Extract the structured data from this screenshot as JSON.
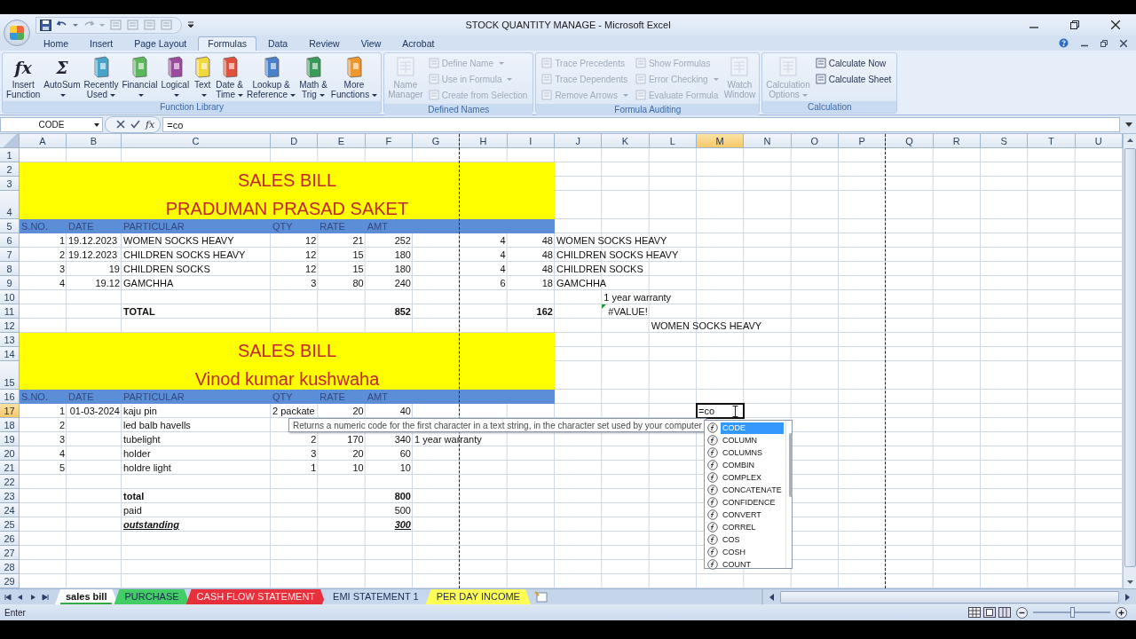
{
  "window": {
    "title": "STOCK QUANTITY MANAGE - Microsoft Excel"
  },
  "ribbon": {
    "tabs": [
      {
        "label": "Home",
        "selected": false
      },
      {
        "label": "Insert",
        "selected": false
      },
      {
        "label": "Page Layout",
        "selected": false
      },
      {
        "label": "Formulas",
        "selected": true
      },
      {
        "label": "Data",
        "selected": false
      },
      {
        "label": "Review",
        "selected": false
      },
      {
        "label": "View",
        "selected": false
      },
      {
        "label": "Acrobat",
        "selected": false
      }
    ],
    "groups": [
      {
        "label": "Function Library",
        "items": [
          {
            "kind": "glyph",
            "glyph": "fx",
            "lines": [
              "Insert",
              "Function"
            ],
            "menu": false,
            "disabled": false
          },
          {
            "kind": "glyph",
            "glyph": "Σ",
            "lines": [
              "AutoSum"
            ],
            "menu": true,
            "disabled": false
          },
          {
            "kind": "book",
            "color": "#4aa3c8",
            "lines": [
              "Recently",
              "Used"
            ],
            "menu": true,
            "disabled": false
          },
          {
            "kind": "book",
            "color": "#5cb85c",
            "lines": [
              "Financial"
            ],
            "menu": true,
            "disabled": false
          },
          {
            "kind": "book",
            "color": "#9b4aa0",
            "lines": [
              "Logical"
            ],
            "menu": true,
            "disabled": false
          },
          {
            "kind": "book",
            "color": "#f0d840",
            "lines": [
              "Text"
            ],
            "menu": true,
            "disabled": false
          },
          {
            "kind": "book",
            "color": "#e0503a",
            "lines": [
              "Date &",
              "Time"
            ],
            "menu": true,
            "disabled": false
          },
          {
            "kind": "book",
            "color": "#4a80c8",
            "lines": [
              "Lookup &",
              "Reference"
            ],
            "menu": true,
            "disabled": false
          },
          {
            "kind": "book",
            "color": "#3a9a5a",
            "lines": [
              "Math &",
              "Trig"
            ],
            "menu": true,
            "disabled": false
          },
          {
            "kind": "book",
            "color": "#f0962a",
            "lines": [
              "More",
              "Functions"
            ],
            "menu": true,
            "disabled": false
          }
        ]
      },
      {
        "label": "Defined Names",
        "items": [
          {
            "kind": "large",
            "lines": [
              "Name",
              "Manager"
            ],
            "menu": false,
            "disabled": true
          },
          {
            "kind": "small",
            "lines": [
              "Define Name"
            ],
            "menu": true,
            "disabled": true
          },
          {
            "kind": "small",
            "lines": [
              "Use in Formula"
            ],
            "menu": true,
            "disabled": true
          },
          {
            "kind": "small",
            "lines": [
              "Create from Selection"
            ],
            "menu": false,
            "disabled": true
          }
        ]
      },
      {
        "label": "Formula Auditing",
        "items": [
          {
            "kind": "small",
            "lines": [
              "Trace Precedents"
            ],
            "menu": false,
            "disabled": true
          },
          {
            "kind": "small",
            "lines": [
              "Trace Dependents"
            ],
            "menu": false,
            "disabled": true
          },
          {
            "kind": "small",
            "lines": [
              "Remove Arrows"
            ],
            "menu": true,
            "disabled": true
          },
          {
            "kind": "small",
            "lines": [
              "Show Formulas"
            ],
            "menu": false,
            "disabled": true
          },
          {
            "kind": "small",
            "lines": [
              "Error Checking"
            ],
            "menu": true,
            "disabled": true
          },
          {
            "kind": "small",
            "lines": [
              "Evaluate Formula"
            ],
            "menu": false,
            "disabled": true
          },
          {
            "kind": "large",
            "lines": [
              "Watch",
              "Window"
            ],
            "menu": false,
            "disabled": true
          }
        ]
      },
      {
        "label": "Calculation",
        "items": [
          {
            "kind": "large",
            "lines": [
              "Calculation",
              "Options"
            ],
            "menu": true,
            "disabled": true
          },
          {
            "kind": "small",
            "lines": [
              "Calculate Now"
            ],
            "menu": false,
            "disabled": false
          },
          {
            "kind": "small",
            "lines": [
              "Calculate Sheet"
            ],
            "menu": false,
            "disabled": false
          }
        ]
      }
    ]
  },
  "formula_bar": {
    "name_box": "CODE",
    "function_button": "fx",
    "formula": "=co"
  },
  "sheet": {
    "columns": [
      {
        "label": "A",
        "page_break_after": false
      },
      {
        "label": "B",
        "page_break_after": false
      },
      {
        "label": "C",
        "page_break_after": false
      },
      {
        "label": "D",
        "page_break_after": false
      },
      {
        "label": "E",
        "page_break_after": false
      },
      {
        "label": "F",
        "page_break_after": false
      },
      {
        "label": "G",
        "page_break_after": true
      },
      {
        "label": "H",
        "page_break_after": false
      },
      {
        "label": "I",
        "page_break_after": false
      },
      {
        "label": "J",
        "page_break_after": false
      },
      {
        "label": "K",
        "page_break_after": false
      },
      {
        "label": "L",
        "page_break_after": false
      },
      {
        "label": "M",
        "page_break_after": false
      },
      {
        "label": "N",
        "page_break_after": false
      },
      {
        "label": "O",
        "page_break_after": false
      },
      {
        "label": "P",
        "page_break_after": true
      },
      {
        "label": "Q",
        "page_break_after": false
      },
      {
        "label": "R",
        "page_break_after": false
      },
      {
        "label": "S",
        "page_break_after": false
      },
      {
        "label": "T",
        "page_break_after": false
      },
      {
        "label": "U",
        "page_break_after": false
      }
    ],
    "rows": [
      {
        "label": "1",
        "kind": "plain"
      },
      {
        "label": "2",
        "kind": "title",
        "title": "SALES BILL"
      },
      {
        "label": "3",
        "kind": "title"
      },
      {
        "label": "4",
        "kind": "title",
        "title": "PRADUMAN PRASAD SAKET"
      },
      {
        "label": "5",
        "kind": "header",
        "cells": {
          "A": {
            "text": "S.NO.",
            "kind": "header"
          },
          "B": {
            "text": "DATE",
            "kind": "header"
          },
          "C": {
            "text": "PARTICULAR",
            "kind": "header"
          },
          "D": {
            "text": "QTY",
            "kind": "header"
          },
          "E": {
            "text": "RATE",
            "kind": "header"
          },
          "F": {
            "text": "AMT",
            "kind": "header"
          }
        }
      },
      {
        "label": "6",
        "kind": "plain",
        "cells": {
          "A": {
            "text": "1",
            "kind": "num"
          },
          "B": {
            "text": "19.12.2023",
            "kind": "text"
          },
          "C": {
            "text": "WOMEN SOCKS HEAVY",
            "kind": "text"
          },
          "D": {
            "text": "12",
            "kind": "num"
          },
          "E": {
            "text": "21",
            "kind": "num"
          },
          "F": {
            "text": "252",
            "kind": "num"
          },
          "H": {
            "text": "4",
            "kind": "num"
          },
          "I": {
            "text": "48",
            "kind": "num"
          },
          "J": {
            "text": "WOMEN SOCKS HEAVY",
            "kind": "text"
          }
        }
      },
      {
        "label": "7",
        "kind": "plain",
        "cells": {
          "A": {
            "text": "2",
            "kind": "num"
          },
          "B": {
            "text": "19.12.2023",
            "kind": "text"
          },
          "C": {
            "text": "CHILDREN SOCKS HEAVY",
            "kind": "text"
          },
          "D": {
            "text": "12",
            "kind": "num"
          },
          "E": {
            "text": "15",
            "kind": "num"
          },
          "F": {
            "text": "180",
            "kind": "num"
          },
          "H": {
            "text": "4",
            "kind": "num"
          },
          "I": {
            "text": "48",
            "kind": "num"
          },
          "J": {
            "text": "CHILDREN SOCKS HEAVY",
            "kind": "text"
          }
        }
      },
      {
        "label": "8",
        "kind": "plain",
        "cells": {
          "A": {
            "text": "3",
            "kind": "num"
          },
          "B": {
            "text": "19",
            "kind": "num"
          },
          "C": {
            "text": "CHILDREN SOCKS",
            "kind": "text"
          },
          "D": {
            "text": "12",
            "kind": "num"
          },
          "E": {
            "text": "15",
            "kind": "num"
          },
          "F": {
            "text": "180",
            "kind": "num"
          },
          "H": {
            "text": "4",
            "kind": "num"
          },
          "I": {
            "text": "48",
            "kind": "num"
          },
          "J": {
            "text": "CHILDREN SOCKS",
            "kind": "text"
          }
        }
      },
      {
        "label": "9",
        "kind": "plain",
        "cells": {
          "A": {
            "text": "4",
            "kind": "num"
          },
          "B": {
            "text": "19.12",
            "kind": "num"
          },
          "C": {
            "text": "GAMCHHA",
            "kind": "text"
          },
          "D": {
            "text": "3",
            "kind": "num"
          },
          "E": {
            "text": "80",
            "kind": "num"
          },
          "F": {
            "text": "240",
            "kind": "num"
          },
          "H": {
            "text": "6",
            "kind": "num"
          },
          "I": {
            "text": "18",
            "kind": "num"
          },
          "J": {
            "text": "GAMCHHA",
            "kind": "text"
          }
        }
      },
      {
        "label": "10",
        "kind": "plain",
        "cells": {
          "K": {
            "text": "1 year warranty",
            "kind": "text"
          }
        }
      },
      {
        "label": "11",
        "kind": "plain",
        "cells": {
          "C": {
            "text": "TOTAL",
            "kind": "text-bold"
          },
          "F": {
            "text": "852",
            "kind": "num-bold"
          },
          "I": {
            "text": "162",
            "kind": "num-bold"
          },
          "K": {
            "text": "#VALUE!",
            "kind": "error"
          }
        }
      },
      {
        "label": "12",
        "kind": "plain",
        "cells": {
          "L": {
            "text": "WOMEN SOCKS HEAVY",
            "kind": "text"
          }
        }
      },
      {
        "label": "13",
        "kind": "title",
        "title": "SALES BILL"
      },
      {
        "label": "14",
        "kind": "title"
      },
      {
        "label": "15",
        "kind": "title",
        "title": "Vinod kumar kushwaha"
      },
      {
        "label": "16",
        "kind": "header",
        "cells": {
          "A": {
            "text": "S.NO.",
            "kind": "header"
          },
          "B": {
            "text": "DATE",
            "kind": "header"
          },
          "C": {
            "text": "PARTICULAR",
            "kind": "header"
          },
          "D": {
            "text": "QTY",
            "kind": "header"
          },
          "E": {
            "text": "RATE",
            "kind": "header"
          },
          "F": {
            "text": "AMT",
            "kind": "header"
          }
        }
      },
      {
        "label": "17",
        "kind": "plain",
        "cells": {
          "A": {
            "text": "1",
            "kind": "num"
          },
          "B": {
            "text": "01-03-2024",
            "kind": "num"
          },
          "C": {
            "text": "kaju pin",
            "kind": "text"
          },
          "D": {
            "text": "2 packate",
            "kind": "text"
          },
          "E": {
            "text": "20",
            "kind": "num"
          },
          "F": {
            "text": "40",
            "kind": "num"
          },
          "M": {
            "text": "=co",
            "kind": "editing"
          }
        }
      },
      {
        "label": "18",
        "kind": "plain",
        "cells": {
          "A": {
            "text": "2",
            "kind": "num"
          },
          "C": {
            "text": "led balb havells",
            "kind": "text"
          }
        }
      },
      {
        "label": "19",
        "kind": "plain",
        "cells": {
          "A": {
            "text": "3",
            "kind": "num"
          },
          "C": {
            "text": "tubelight",
            "kind": "text"
          },
          "D": {
            "text": "2",
            "kind": "num"
          },
          "E": {
            "text": "170",
            "kind": "num"
          },
          "F": {
            "text": "340",
            "kind": "num"
          },
          "G": {
            "text": "1 year warranty",
            "kind": "text"
          }
        }
      },
      {
        "label": "20",
        "kind": "plain",
        "cells": {
          "A": {
            "text": "4",
            "kind": "num"
          },
          "C": {
            "text": "holder",
            "kind": "text"
          },
          "D": {
            "text": "3",
            "kind": "num"
          },
          "E": {
            "text": "20",
            "kind": "num"
          },
          "F": {
            "text": "60",
            "kind": "num"
          }
        }
      },
      {
        "label": "21",
        "kind": "plain",
        "cells": {
          "A": {
            "text": "5",
            "kind": "num"
          },
          "C": {
            "text": "holdre light",
            "kind": "text"
          },
          "D": {
            "text": "1",
            "kind": "num"
          },
          "E": {
            "text": "10",
            "kind": "num"
          },
          "F": {
            "text": "10",
            "kind": "num"
          }
        }
      },
      {
        "label": "22",
        "kind": "plain"
      },
      {
        "label": "23",
        "kind": "plain",
        "cells": {
          "C": {
            "text": "total",
            "kind": "text-bold"
          },
          "F": {
            "text": "800",
            "kind": "num-bold"
          }
        }
      },
      {
        "label": "24",
        "kind": "plain",
        "cells": {
          "C": {
            "text": "paid",
            "kind": "text"
          },
          "F": {
            "text": "500",
            "kind": "num"
          }
        }
      },
      {
        "label": "25",
        "kind": "plain",
        "cells": {
          "C": {
            "text": "outstanding",
            "kind": "text-emph"
          },
          "F": {
            "text": "300",
            "kind": "num-emph"
          }
        }
      },
      {
        "label": "26",
        "kind": "plain"
      },
      {
        "label": "27",
        "kind": "plain"
      },
      {
        "label": "28",
        "kind": "plain"
      },
      {
        "label": "29",
        "kind": "plain"
      }
    ]
  },
  "tooltip": {
    "text": "Returns a numeric code for the first character in a text string, in the character set used by your computer"
  },
  "autocomplete": {
    "items": [
      {
        "label": "CODE",
        "selected": true
      },
      {
        "label": "COLUMN",
        "selected": false
      },
      {
        "label": "COLUMNS",
        "selected": false
      },
      {
        "label": "COMBIN",
        "selected": false
      },
      {
        "label": "COMPLEX",
        "selected": false
      },
      {
        "label": "CONCATENATE",
        "selected": false
      },
      {
        "label": "CONFIDENCE",
        "selected": false
      },
      {
        "label": "CONVERT",
        "selected": false
      },
      {
        "label": "CORREL",
        "selected": false
      },
      {
        "label": "COS",
        "selected": false
      },
      {
        "label": "COSH",
        "selected": false
      },
      {
        "label": "COUNT",
        "selected": false
      }
    ]
  },
  "sheet_tabs": [
    {
      "label": "sales bill",
      "selected": true,
      "color": "#33aa44"
    },
    {
      "label": "PURCHASE",
      "selected": false,
      "color": "#44cc66"
    },
    {
      "label": "CASH FLOW STATEMENT",
      "selected": false,
      "color": "#e8303c"
    },
    {
      "label": "EMI STATEMENT 1",
      "selected": false,
      "color": "#c6d8ee"
    },
    {
      "label": "PER DAY INCOME",
      "selected": false,
      "color": "#ffff55"
    }
  ],
  "status_bar": {
    "mode": "Enter",
    "zoom": {
      "level": 0.5
    }
  }
}
